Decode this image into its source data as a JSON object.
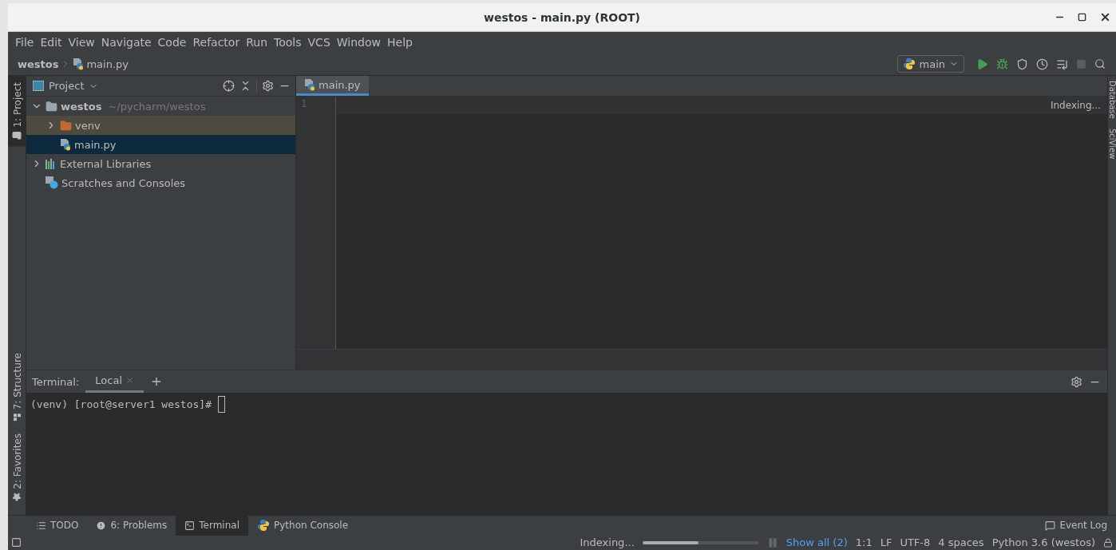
{
  "window": {
    "title": "westos - main.py (ROOT)"
  },
  "menu": [
    "File",
    "Edit",
    "View",
    "Navigate",
    "Code",
    "Refactor",
    "Run",
    "Tools",
    "VCS",
    "Window",
    "Help"
  ],
  "breadcrumb": [
    {
      "label": "westos",
      "kind": "project"
    },
    {
      "label": "main.py",
      "kind": "python-file"
    }
  ],
  "run_config": {
    "label": "main"
  },
  "left_stripe": [
    {
      "label": "1: Project",
      "selected": true,
      "kind": "project"
    },
    {
      "label": "7: Structure",
      "selected": false,
      "kind": "structure"
    },
    {
      "label": "2: Favorites",
      "selected": false,
      "kind": "favorites"
    }
  ],
  "project_panel": {
    "title": "Project",
    "tree": [
      {
        "label": "westos",
        "hint": "~/pycharm/westos",
        "kind": "folder",
        "expanded": true,
        "selected": false,
        "children": [
          {
            "label": "venv",
            "kind": "excluded-folder",
            "expanded": false,
            "selected": false
          },
          {
            "label": "main.py",
            "kind": "python-file",
            "selected": true
          }
        ]
      },
      {
        "label": "External Libraries",
        "kind": "libraries",
        "expanded": false,
        "selected": false
      },
      {
        "label": "Scratches and Consoles",
        "kind": "scratches",
        "selected": false
      }
    ]
  },
  "editor": {
    "tabs": [
      {
        "label": "main.py",
        "selected": true
      }
    ],
    "line_numbers": [
      "1"
    ],
    "notice": "Indexing..."
  },
  "right_stripe": [
    "Database",
    "SciView"
  ],
  "terminal": {
    "title": "Terminal:",
    "tabs": [
      {
        "label": "Local",
        "selected": true
      }
    ],
    "prompt": "(venv) [root@server1 westos]#"
  },
  "tool_tabs": [
    {
      "label": "TODO",
      "kind": "todo",
      "selected": false
    },
    {
      "label": "6: Problems",
      "kind": "problems",
      "selected": false
    },
    {
      "label": "Terminal",
      "kind": "terminal",
      "selected": true
    },
    {
      "label": "Python Console",
      "kind": "python",
      "selected": false
    }
  ],
  "event_log": "Event Log",
  "status_bar": {
    "indexing": "Indexing...",
    "level": 0.48,
    "show_all": "Show all (2)",
    "items": [
      "1:1",
      "LF",
      "UTF-8",
      "4 spaces",
      "Python 3.6 (westos)"
    ]
  }
}
